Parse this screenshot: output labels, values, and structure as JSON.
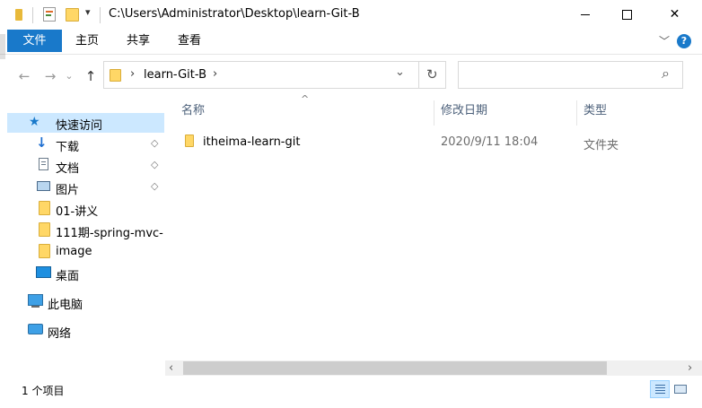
{
  "window": {
    "title": "C:\\Users\\Administrator\\Desktop\\learn-Git-B",
    "minimize_glyph": "—",
    "maximize_glyph": "☐",
    "close_glyph": "✕",
    "qat_dropdown_glyph": "▾"
  },
  "ribbon": {
    "tabs": [
      {
        "label": "文件",
        "active": true
      },
      {
        "label": "主页"
      },
      {
        "label": "共享"
      },
      {
        "label": "查看"
      }
    ],
    "expand_glyph": "﹀",
    "help_glyph": "?"
  },
  "navigation": {
    "back_glyph": "←",
    "forward_glyph": "→",
    "recent_glyph": "⌄",
    "up_glyph": "↑",
    "breadcrumb_sep": "›",
    "path_segment": "learn-Git-B",
    "path_sep_after": "›",
    "dropdown_glyph": "⌄",
    "refresh_glyph": "↻",
    "search_placeholder": "",
    "search_icon_glyph": "⌕"
  },
  "sidebar": {
    "quick_access": "快速访问",
    "items": [
      {
        "label": "下载",
        "icon": "download-icon",
        "pinned": true
      },
      {
        "label": "文档",
        "icon": "documents-icon",
        "pinned": true
      },
      {
        "label": "图片",
        "icon": "pictures-icon",
        "pinned": true
      },
      {
        "label": "01-讲义",
        "icon": "folder-icon",
        "pinned": false
      },
      {
        "label": "111期-spring-mvc-",
        "icon": "folder-icon",
        "pinned": false
      },
      {
        "label": "image",
        "icon": "folder-icon",
        "pinned": false
      },
      {
        "label": "桌面",
        "icon": "desktop-icon",
        "pinned": false
      }
    ],
    "this_pc": "此电脑",
    "network": "网络",
    "pin_glyph": "📌"
  },
  "content": {
    "sort_indicator": "^",
    "columns": [
      "名称",
      "修改日期",
      "类型"
    ],
    "rows": [
      {
        "name": "itheima-learn-git",
        "modified": "2020/9/11 18:04",
        "type": "文件夹"
      }
    ],
    "scroll_left": "‹",
    "scroll_right": "›"
  },
  "status": {
    "item_count": "1 个项目"
  },
  "colors": {
    "accent": "#1979ca",
    "selection": "#cce8ff",
    "folder": "#ffd766"
  }
}
